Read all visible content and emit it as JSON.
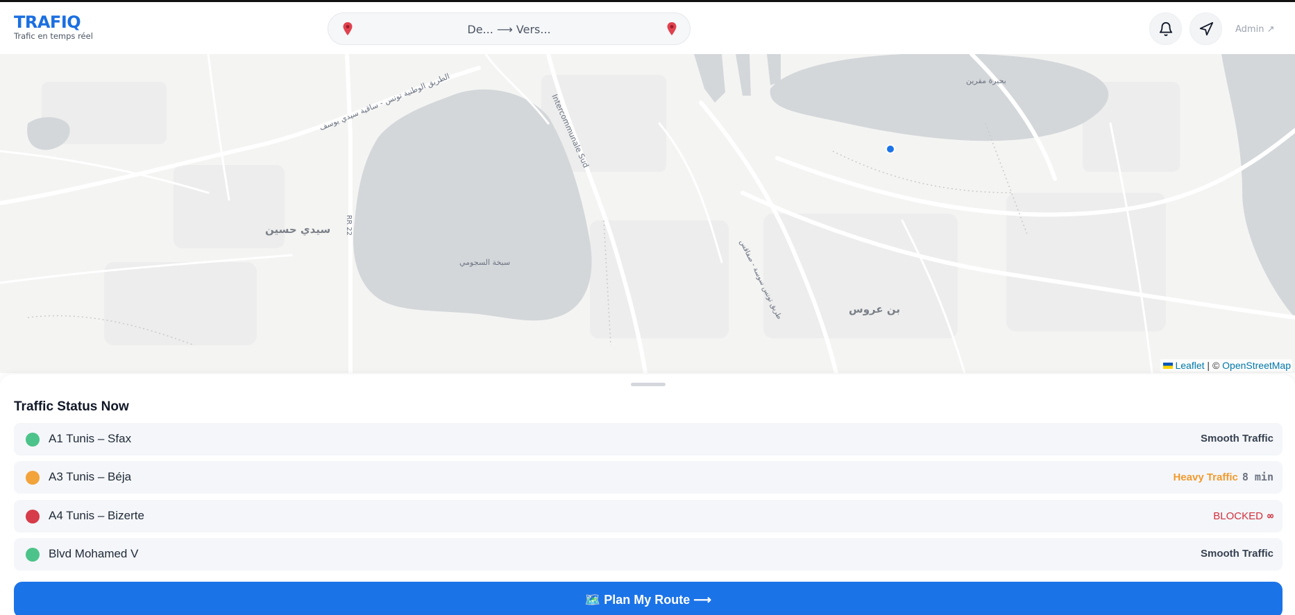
{
  "app": {
    "brand": "TRAFIQ",
    "tagline": "Trafic en temps réel",
    "accent_color": "#1b73e8"
  },
  "header": {
    "search_text": "De... ⟶ Vers...",
    "from_icon": "map-pin-icon",
    "to_icon": "map-pin-icon",
    "notifications_icon": "bell-icon",
    "navigate_icon": "navigation-arrow-icon",
    "admin_label": "Admin ↗"
  },
  "map": {
    "labels": {
      "lake_north": "بحيرة مقرين",
      "sidi_hassine": "سيدي حسين",
      "sebkha": "سبخة السجومي",
      "ben_arous": "بن عروس",
      "road_intercommunale": "Intercommunale Sud",
      "road_rr22": "RR 22",
      "road_national": "الطريق الوطنية تونس - ساقية سيدي يوسف",
      "road_south": "طريق تونس سوسة - صفاقس"
    },
    "attribution": {
      "leaflet": "Leaflet",
      "separator": " | © ",
      "osm": "OpenStreetMap"
    },
    "colors": {
      "land": "#f4f4f3",
      "water": "#d4d7da",
      "road": "#ffffff",
      "position_dot": "#1b73e8"
    }
  },
  "traffic": {
    "title": "Traffic Status Now",
    "items": [
      {
        "road": "A1 Tunis – Sfax",
        "status": "Smooth Traffic",
        "extra": "",
        "dot_color": "#4cc38a",
        "status_color": "#374151"
      },
      {
        "road": "A3 Tunis – Béja",
        "status": "Heavy Traffic",
        "extra": "8 min",
        "dot_color": "#f2a33a",
        "status_color": "#f29a2e"
      },
      {
        "road": "A4 Tunis – Bizerte",
        "status": "BLOCKED",
        "extra": "∞",
        "dot_color": "#d63c4a",
        "status_color": "#d0313f"
      },
      {
        "road": "Blvd Mohamed V",
        "status": "Smooth Traffic",
        "extra": "",
        "dot_color": "#4cc38a",
        "status_color": "#374151"
      }
    ]
  },
  "cta": {
    "label": "🗺️ Plan My Route ⟶",
    "icon": "map-icon"
  }
}
